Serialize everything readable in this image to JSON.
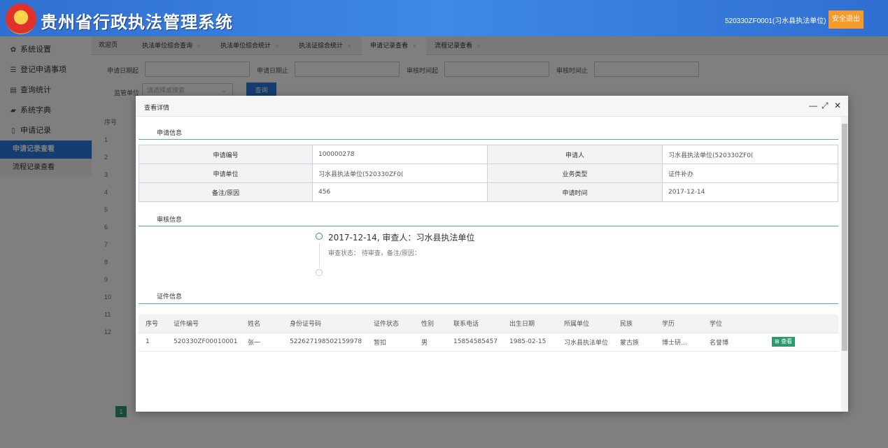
{
  "header": {
    "app_title": "贵州省行政执法管理系统",
    "user_info": "520330ZF0001(习水县执法单位)",
    "logout_label": "安全退出",
    "colors": {
      "header_blue": "#3f88e6",
      "logout_orange": "#f79a2a"
    }
  },
  "sidebar": {
    "items": [
      {
        "icon": "gear-icon",
        "glyph": "✿",
        "label": "系统设置"
      },
      {
        "icon": "sliders-icon",
        "glyph": "☰",
        "label": "登记申请事项"
      },
      {
        "icon": "database-icon",
        "glyph": "▤",
        "label": "查询统计"
      },
      {
        "icon": "book-icon",
        "glyph": "▰",
        "label": "系统字典"
      },
      {
        "icon": "document-icon",
        "glyph": "▯",
        "label": "申请记录"
      }
    ],
    "subitems": [
      {
        "label": "申请记录查看",
        "active": true
      },
      {
        "label": "流程记录查看",
        "active": false
      }
    ],
    "active_color": "#2d7ae0"
  },
  "tabs": [
    {
      "label": "欢迎页"
    },
    {
      "label": "执法单位综合查询"
    },
    {
      "label": "执法单位综合统计"
    },
    {
      "label": "执法证综合统计"
    },
    {
      "label": "申请记录查看"
    },
    {
      "label": "流程记录查看"
    }
  ],
  "tab_close": "×",
  "filters": {
    "apply_date_from": "申请日期起",
    "apply_date_to": "申请日期止",
    "review_time_from": "审核时间起",
    "review_time_to": "审核时间止",
    "org_label": "监管单位",
    "org_placeholder": "请选择或搜索",
    "query_label": "查询"
  },
  "background_table": {
    "seq_header": "序号",
    "row_numbers": [
      "1",
      "2",
      "3",
      "4",
      "5",
      "6",
      "7",
      "8",
      "9",
      "10",
      "11",
      "12"
    ]
  },
  "pager": {
    "current": "1"
  },
  "modal": {
    "title": "查看详情",
    "controls": {
      "minimize": "—",
      "maximize": "⤢",
      "close": "✕"
    },
    "apply_section": "申请信息",
    "apply_info": {
      "apply_no_label": "申请编号",
      "apply_no": "100000278",
      "applicant_label": "申请人",
      "applicant": "习水县执法单位(520330ZF0(",
      "apply_unit_label": "申请单位",
      "apply_unit": "习水县执法单位(520330ZF0(",
      "biz_type_label": "业务类型",
      "biz_type": "证件补办",
      "remark_label": "备注/原因",
      "remark": "456",
      "apply_time_label": "申请时间",
      "apply_time": "2017-12-14"
    },
    "review_section": "审核信息",
    "timeline": {
      "title": "2017-12-14,  审查人：习水县执法单位",
      "detail": "审查状态：  待审查，备注/原因："
    },
    "cert_section": "证件信息",
    "cert_table": {
      "headers": [
        "序号",
        "证件编号",
        "姓名",
        "身份证号码",
        "证件状态",
        "性别",
        "联系电话",
        "出生日期",
        "所属单位",
        "民族",
        "学历",
        "学位",
        ""
      ],
      "rows": [
        {
          "seq": "1",
          "cert_no": "520330ZF00010001",
          "name": "张一",
          "id_no": "522627198502159978",
          "status": "暂扣",
          "gender": "男",
          "phone": "15854585457",
          "birth": "1985-02-15",
          "unit": "习水县执法单位",
          "ethnic": "蒙古族",
          "education": "博士研…",
          "degree": "名誉博",
          "action": "查看"
        }
      ]
    },
    "accent_line_color": "#5aa6c8",
    "action_color": "#2d9a6d"
  }
}
